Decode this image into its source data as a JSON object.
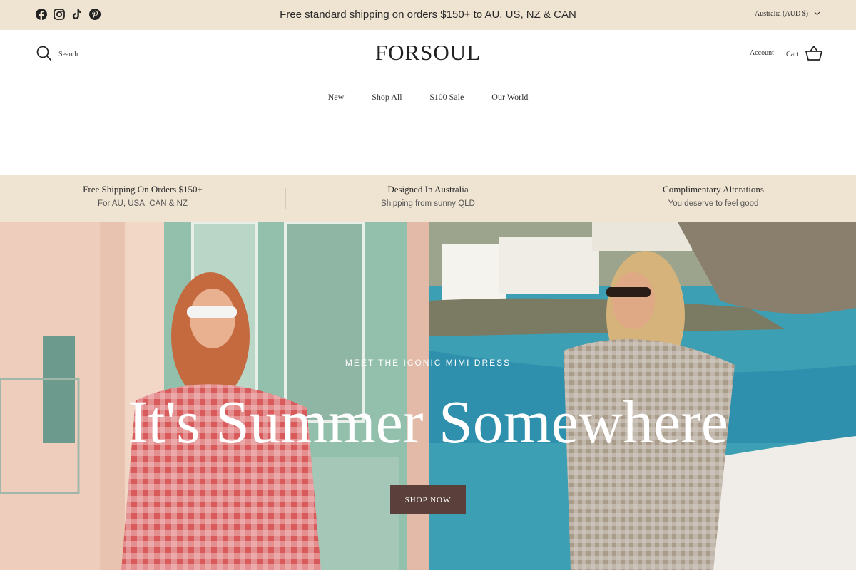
{
  "announcement": {
    "text": "Free standard shipping on orders $150+ to AU, US, NZ & CAN",
    "currency": "Australia (AUD $)",
    "social_icons": [
      "facebook-icon",
      "instagram-icon",
      "tiktok-icon",
      "pinterest-icon"
    ]
  },
  "header": {
    "search_label": "Search",
    "logo": "FORSOUL",
    "account_label": "Account",
    "cart_label": "Cart"
  },
  "nav": {
    "items": [
      "New",
      "Shop All",
      "$100 Sale",
      "Our World"
    ]
  },
  "usp": [
    {
      "title": "Free Shipping On Orders $150+",
      "sub": "For AU, USA, CAN & NZ"
    },
    {
      "title": "Designed In Australia",
      "sub": "Shipping from sunny QLD"
    },
    {
      "title": "Complimentary Alterations",
      "sub": "You deserve to feel good"
    }
  ],
  "hero": {
    "kicker": "MEET THE ICONIC MIMI DRESS",
    "title": "It's Summer Somewhere",
    "button": "SHOP NOW"
  },
  "colors": {
    "announcement_bg": "#efe3d1",
    "button_bg": "#5a3f3a"
  }
}
